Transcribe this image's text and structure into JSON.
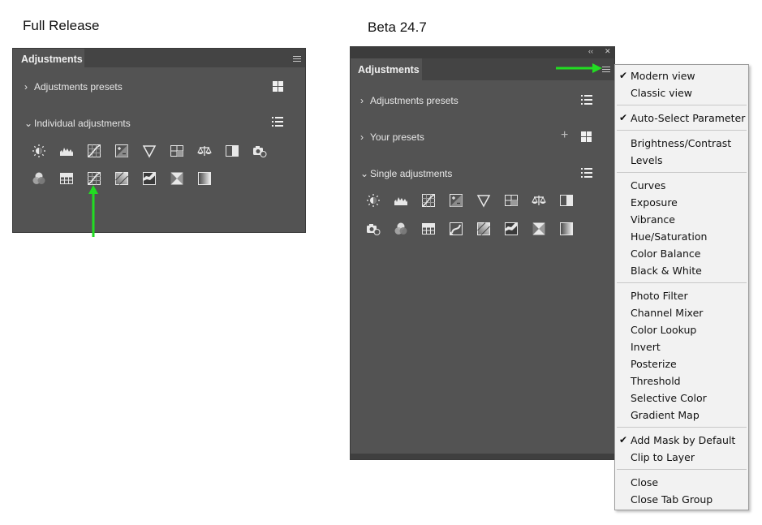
{
  "left": {
    "caption": "Full Release",
    "tab_title": "Adjustments",
    "sections": [
      {
        "label": "Adjustments presets",
        "expanded": false,
        "view_icon": "grid-view-icon"
      },
      {
        "label": "Individual adjustments",
        "expanded": true,
        "view_icon": "list-view-icon"
      }
    ],
    "icons_row1": [
      "brightness-contrast-icon",
      "levels-icon",
      "curves-icon",
      "exposure-icon",
      "vibrance-icon",
      "hue-saturation-icon",
      "color-balance-icon",
      "black-white-icon",
      "photo-filter-icon"
    ],
    "icons_row2": [
      "channel-mixer-icon",
      "color-lookup-icon",
      "curves-icon",
      "posterize-icon",
      "threshold-icon",
      "selective-color-icon",
      "gradient-map-icon"
    ],
    "arrow_color": "#22dd22"
  },
  "right": {
    "caption": "Beta 24.7",
    "tab_title": "Adjustments",
    "sections": [
      {
        "label": "Adjustments presets",
        "expanded": false
      },
      {
        "label": "Your presets",
        "expanded": false
      },
      {
        "label": "Single adjustments",
        "expanded": true
      }
    ],
    "icons_row1": [
      "brightness-contrast-icon",
      "levels-icon",
      "curves-icon",
      "exposure-icon",
      "vibrance-icon",
      "hue-saturation-icon",
      "color-balance-icon",
      "black-white-icon"
    ],
    "icons_row2": [
      "photo-filter-icon",
      "channel-mixer-icon",
      "color-lookup-icon",
      "invert-icon",
      "posterize-icon",
      "threshold-icon",
      "selective-color-icon",
      "gradient-map-icon"
    ],
    "collapse_glyph": "‹‹",
    "close_glyph": "✕"
  },
  "menu": {
    "items": [
      {
        "label": "Modern view",
        "checked": true
      },
      {
        "label": "Classic view",
        "checked": false
      },
      {
        "label": "Auto-Select Parameter",
        "checked": true
      },
      {
        "label": "Brightness/Contrast",
        "checked": false
      },
      {
        "label": "Levels",
        "checked": false
      },
      {
        "label": "Curves",
        "checked": false
      },
      {
        "label": "Exposure",
        "checked": false
      },
      {
        "label": "Vibrance",
        "checked": false
      },
      {
        "label": "Hue/Saturation",
        "checked": false
      },
      {
        "label": "Color Balance",
        "checked": false
      },
      {
        "label": "Black & White",
        "checked": false
      },
      {
        "label": "Photo Filter",
        "checked": false
      },
      {
        "label": "Channel Mixer",
        "checked": false
      },
      {
        "label": "Color Lookup",
        "checked": false
      },
      {
        "label": "Invert",
        "checked": false
      },
      {
        "label": "Posterize",
        "checked": false
      },
      {
        "label": "Threshold",
        "checked": false
      },
      {
        "label": "Selective Color",
        "checked": false
      },
      {
        "label": "Gradient Map",
        "checked": false
      },
      {
        "label": "Add Mask by Default",
        "checked": true
      },
      {
        "label": "Clip to Layer",
        "checked": false
      },
      {
        "label": "Close",
        "checked": false
      },
      {
        "label": "Close Tab Group",
        "checked": false
      }
    ],
    "check_glyph": "✔"
  }
}
